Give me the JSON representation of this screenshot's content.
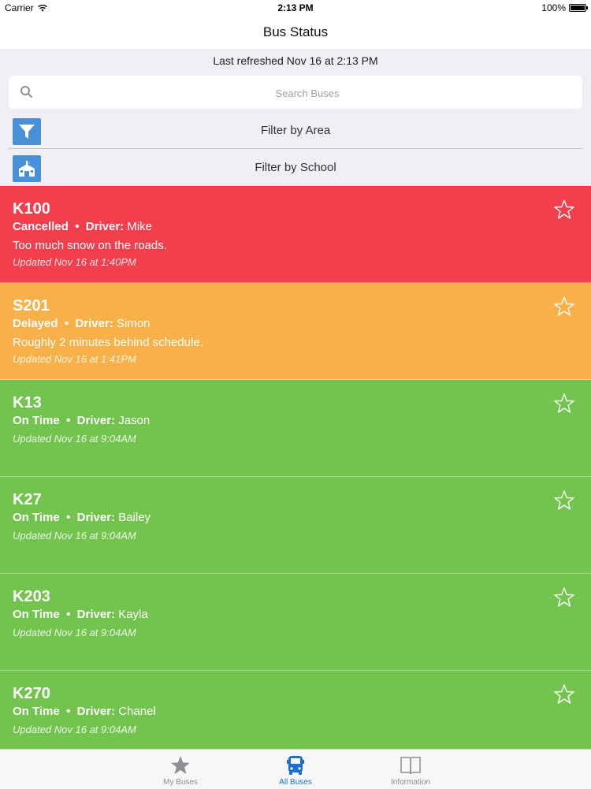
{
  "status_bar": {
    "carrier": "Carrier",
    "time": "2:13 PM",
    "battery": "100%"
  },
  "nav": {
    "title": "Bus Status"
  },
  "refresh_text": "Last refreshed Nov 16 at 2:13 PM",
  "search": {
    "placeholder": "Search Buses",
    "icon": "search-icon"
  },
  "filters": {
    "area": {
      "label": "Filter by Area",
      "icon": "funnel-icon"
    },
    "school": {
      "label": "Filter by School",
      "icon": "school-icon"
    }
  },
  "colors": {
    "cancelled": "#f33e4d",
    "delayed": "#f8b049",
    "on_time": "#73c44f",
    "tab_active": "#1a6fd6",
    "tab_inactive": "#8e8e93"
  },
  "driver_label": "Driver:",
  "buses": [
    {
      "id": "K100",
      "status": "Cancelled",
      "driver": "Mike",
      "note": "Too much snow on the roads.",
      "updated": "Updated Nov 16 at 1:40PM",
      "color": "#f33e4d"
    },
    {
      "id": "S201",
      "status": "Delayed",
      "driver": "Simon",
      "note": "Roughly 2 minutes behind schedule.",
      "updated": "Updated Nov 16 at 1:41PM",
      "color": "#f8b049"
    },
    {
      "id": "K13",
      "status": "On Time",
      "driver": "Jason",
      "note": "",
      "updated": "Updated Nov 16 at 9:04AM",
      "color": "#73c44f"
    },
    {
      "id": "K27",
      "status": "On Time",
      "driver": "Bailey",
      "note": "",
      "updated": "Updated Nov 16 at 9:04AM",
      "color": "#73c44f"
    },
    {
      "id": "K203",
      "status": "On Time",
      "driver": "Kayla",
      "note": "",
      "updated": "Updated Nov 16 at 9:04AM",
      "color": "#73c44f"
    },
    {
      "id": "K270",
      "status": "On Time",
      "driver": "Chanel",
      "note": "",
      "updated": "Updated Nov 16 at 9:04AM",
      "color": "#73c44f"
    }
  ],
  "tabs": [
    {
      "label": "My Buses",
      "icon": "star-icon",
      "active": false
    },
    {
      "label": "All Buses",
      "icon": "bus-icon",
      "active": true
    },
    {
      "label": "Information",
      "icon": "book-icon",
      "active": false
    }
  ]
}
